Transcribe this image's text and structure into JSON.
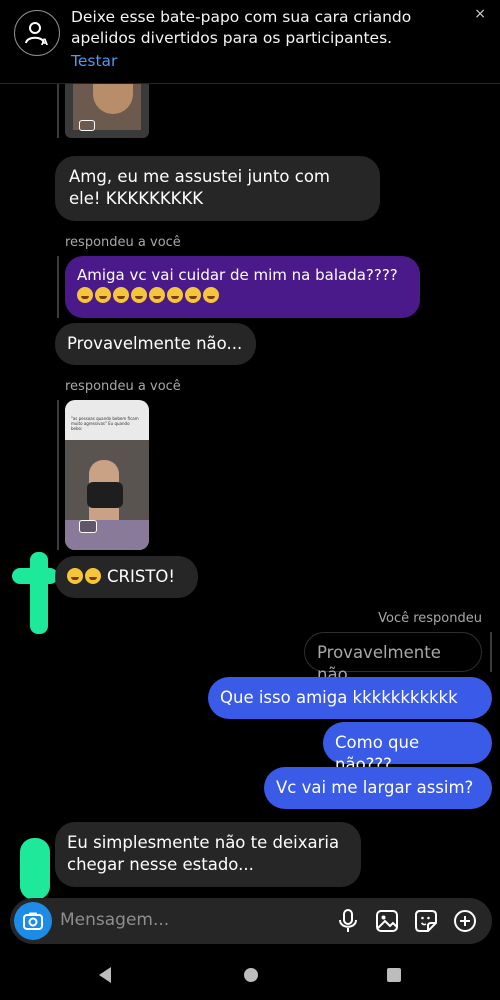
{
  "banner": {
    "text": "Deixe esse bate-papo com sua cara criando apelidos divertidos para os participantes.",
    "link": "Testar",
    "close": "×"
  },
  "messages": {
    "m1": "Amg, eu me assustei junto com ele! KKKKKKKKK",
    "reply_label_1": "respondeu a você",
    "quoted_1": "Amiga vc vai cuidar de mim na balada????",
    "m2": "Provavelmente não...",
    "reply_label_2": "respondeu a você",
    "thumb2_caption": "\"as pessoas quando bebem ficam muito agressivas\" Eu quando bebo:",
    "m3": "CRISTO!",
    "you_replied": "Você respondeu",
    "quoted_self": "Provavelmente não...",
    "out1": "Que isso amiga kkkkkkkkkkk",
    "out2": "Como que não???",
    "out3": "Vc vai me largar assim?",
    "m4": "Eu simplesmente não te deixaria chegar nesse estado..."
  },
  "input": {
    "placeholder": "Mensagem..."
  },
  "icons": {
    "camera": "camera-icon",
    "mic": "microphone-icon",
    "gallery": "gallery-icon",
    "sticker": "sticker-icon",
    "add": "plus-circle-icon"
  },
  "colors": {
    "outgoing": "#3a5ae8",
    "incoming": "#262626",
    "quoted": "#4b1a8a",
    "link": "#4c9af5",
    "camera": "#1d8ce8"
  }
}
